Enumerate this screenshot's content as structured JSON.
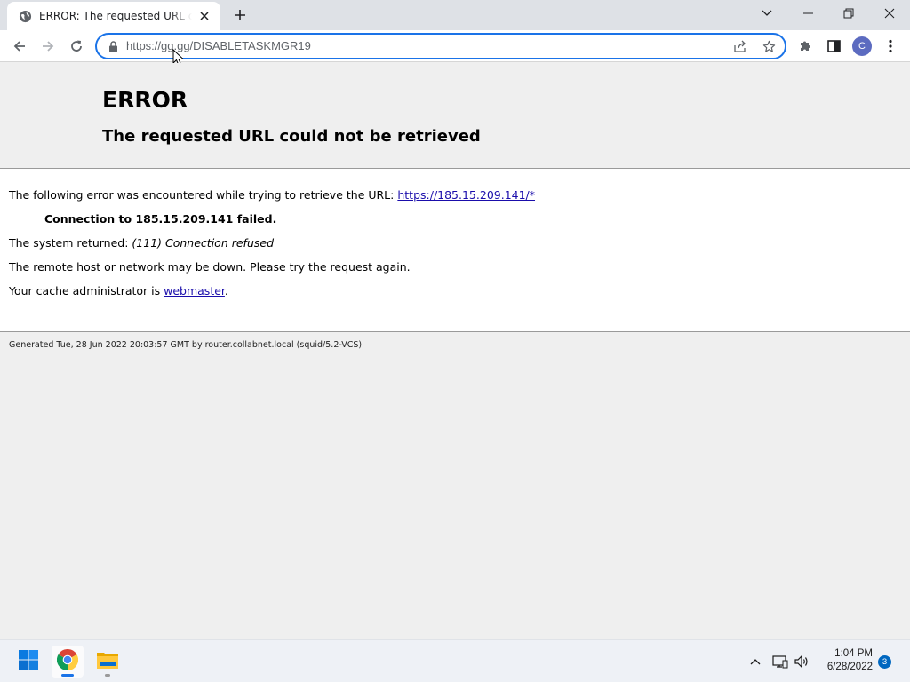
{
  "browser": {
    "tab": {
      "title": "ERROR: The requested URL could not be retrieved",
      "favicon": "globe-icon"
    },
    "address_bar": {
      "url": "https://gg.gg/DISABLETASKMGR19"
    },
    "profile_initial": "C",
    "colors": {
      "titlebar": "#dee1e6",
      "omnibox_focus": "#1a73e8",
      "avatar": "#5c6bc0"
    }
  },
  "page": {
    "title": "ERROR",
    "subtitle": "The requested URL could not be retrieved",
    "intro_text": "The following error was encountered while trying to retrieve the URL: ",
    "intro_link": "https://185.15.209.141/*",
    "error_detail": "Connection to 185.15.209.141 failed.",
    "system_returned_label": "The system returned: ",
    "system_returned_value": "(111) Connection refused",
    "advice": "The remote host or network may be down. Please try the request again.",
    "cache_admin_text": "Your cache administrator is ",
    "cache_admin_link": "webmaster",
    "cache_admin_suffix": ".",
    "footer": "Generated Tue, 28 Jun 2022 20:03:57 GMT by router.collabnet.local (squid/5.2-VCS)"
  },
  "taskbar": {
    "apps": [
      "start-icon",
      "chrome-icon",
      "file-explorer-icon"
    ],
    "time": "1:04 PM",
    "date": "6/28/2022",
    "notification_count": "3"
  }
}
